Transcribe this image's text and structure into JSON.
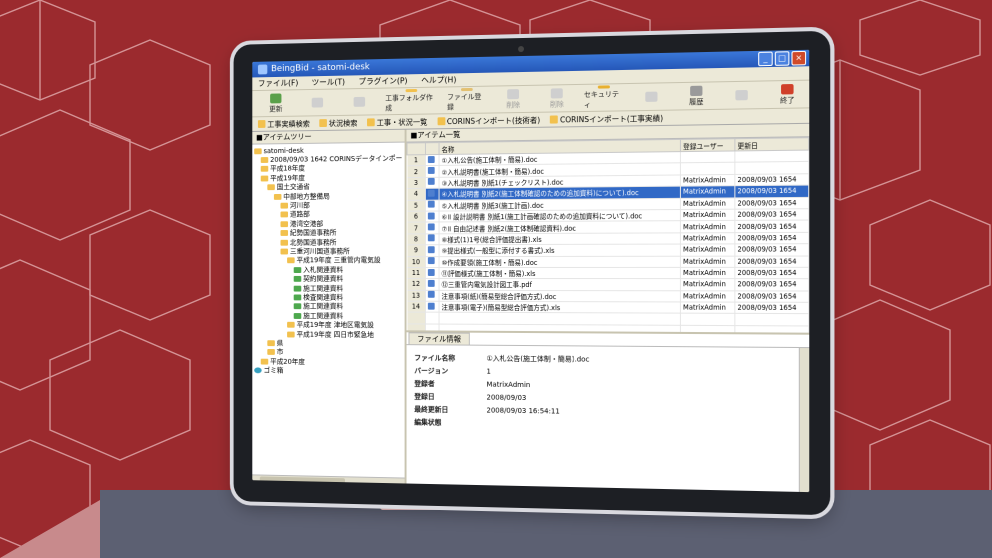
{
  "window": {
    "title": "BeingBid - satomi-desk"
  },
  "menu": [
    "ファイル(F)",
    "ツール(T)",
    "プラグイン(P)",
    "ヘルプ(H)"
  ],
  "toolbar": [
    {
      "label": "更新",
      "icon": "refresh-icon",
      "disabled": false
    },
    {
      "label": "",
      "icon": "blank-icon",
      "disabled": true
    },
    {
      "label": "",
      "icon": "blank-icon",
      "disabled": true
    },
    {
      "label": "工事フォルダ作成",
      "icon": "folder-add-icon",
      "disabled": false
    },
    {
      "label": "ファイル登録",
      "icon": "file-add-icon",
      "disabled": false
    },
    {
      "label": "削除",
      "icon": "delete-icon",
      "disabled": true
    },
    {
      "label": "削除",
      "icon": "trash-icon",
      "disabled": true
    },
    {
      "label": "セキュリティ",
      "icon": "lock-icon",
      "disabled": false
    },
    {
      "label": "",
      "icon": "blank-icon",
      "disabled": true
    },
    {
      "label": "履歴",
      "icon": "history-icon",
      "disabled": false
    },
    {
      "label": "",
      "icon": "blank-icon",
      "disabled": true
    },
    {
      "label": "終了",
      "icon": "exit-icon",
      "disabled": false
    }
  ],
  "toolbar2": [
    "工事実績検索",
    "状況検索",
    "工事・状況一覧",
    "CORINSインポート(技術者)",
    "CORINSインポート(工事実績)"
  ],
  "tree_pane": {
    "header": "■アイテムツリー",
    "nodes": [
      {
        "label": "satomi-desk",
        "level": 0,
        "kind": "root"
      },
      {
        "label": "2008/09/03 1642 CORINSデータインポート",
        "level": 1,
        "kind": "folder"
      },
      {
        "label": "平成18年度",
        "level": 1,
        "kind": "folder"
      },
      {
        "label": "平成19年度",
        "level": 1,
        "kind": "folder"
      },
      {
        "label": "国土交通省",
        "level": 2,
        "kind": "folder"
      },
      {
        "label": "中部地方整備局",
        "level": 3,
        "kind": "folder"
      },
      {
        "label": "河川部",
        "level": 4,
        "kind": "folder"
      },
      {
        "label": "道路部",
        "level": 4,
        "kind": "folder"
      },
      {
        "label": "港湾空港部",
        "level": 4,
        "kind": "folder"
      },
      {
        "label": "紀勢国道事務所",
        "level": 4,
        "kind": "folder"
      },
      {
        "label": "北勢国道事務所",
        "level": 4,
        "kind": "folder"
      },
      {
        "label": "三重河川国道事務所",
        "level": 4,
        "kind": "folder"
      },
      {
        "label": "平成19年度 三重管内電気設",
        "level": 5,
        "kind": "folder"
      },
      {
        "label": "入札関連資料",
        "level": 6,
        "kind": "doc"
      },
      {
        "label": "契約関連資料",
        "level": 6,
        "kind": "doc"
      },
      {
        "label": "施工関連資料",
        "level": 6,
        "kind": "doc"
      },
      {
        "label": "検査関連資料",
        "level": 6,
        "kind": "doc"
      },
      {
        "label": "施工関連資料",
        "level": 6,
        "kind": "doc"
      },
      {
        "label": "施工関連資料",
        "level": 6,
        "kind": "doc"
      },
      {
        "label": "平成19年度 津地区電気設",
        "level": 5,
        "kind": "folder"
      },
      {
        "label": "平成19年度 四日市緊急地",
        "level": 5,
        "kind": "folder"
      },
      {
        "label": "県",
        "level": 2,
        "kind": "folder"
      },
      {
        "label": "市",
        "level": 2,
        "kind": "folder"
      },
      {
        "label": "平成20年度",
        "level": 1,
        "kind": "folder"
      },
      {
        "label": "ゴミ箱",
        "level": 0,
        "kind": "recycle"
      }
    ]
  },
  "list_pane": {
    "header": "■アイテム一覧",
    "columns": [
      "名称",
      "登録ユーザー",
      "更新日"
    ],
    "rows": [
      {
        "num": "1",
        "name": "①入札公告(施工体制・簡易).doc",
        "user": "",
        "date": ""
      },
      {
        "num": "2",
        "name": "②入札説明書(施工体制・簡易).doc",
        "user": "",
        "date": ""
      },
      {
        "num": "3",
        "name": "③入札説明書 別紙1(チェックリスト).doc",
        "user": "MatrixAdmin",
        "date": "2008/09/03 1654"
      },
      {
        "num": "4",
        "name": "④入札説明書 別紙2(施工体制確認のための追加資料)について).doc",
        "user": "MatrixAdmin",
        "date": "2008/09/03 1654"
      },
      {
        "num": "5",
        "name": "⑤入札説明書 別紙3(施工計画).doc",
        "user": "MatrixAdmin",
        "date": "2008/09/03 1654"
      },
      {
        "num": "6",
        "name": "⑥II 設計説明書 別紙1(施工計画確認のための追加資料について).doc",
        "user": "MatrixAdmin",
        "date": "2008/09/03 1654"
      },
      {
        "num": "7",
        "name": "⑦II 自由記述書 別紙2(施工体制確認資料).doc",
        "user": "MatrixAdmin",
        "date": "2008/09/03 1654"
      },
      {
        "num": "8",
        "name": "⑧様式(1)1号(総合評価提出書).xls",
        "user": "MatrixAdmin",
        "date": "2008/09/03 1654"
      },
      {
        "num": "9",
        "name": "⑨提出様式(一般型に添付する書式).xls",
        "user": "MatrixAdmin",
        "date": "2008/09/03 1654"
      },
      {
        "num": "10",
        "name": "⑩作成要領(施工体制・簡易).doc",
        "user": "MatrixAdmin",
        "date": "2008/09/03 1654"
      },
      {
        "num": "11",
        "name": "⑪評価様式(施工体制・簡易).xls",
        "user": "MatrixAdmin",
        "date": "2008/09/03 1654"
      },
      {
        "num": "12",
        "name": "⑫三重管内電気設計図工事.pdf",
        "user": "MatrixAdmin",
        "date": "2008/09/03 1654"
      },
      {
        "num": "13",
        "name": "注意事項(紙)(簡易型総合評価方式).doc",
        "user": "MatrixAdmin",
        "date": "2008/09/03 1654"
      },
      {
        "num": "14",
        "name": "注意事項(電子)(簡易型総合評価方式).xls",
        "user": "MatrixAdmin",
        "date": "2008/09/03 1654"
      }
    ],
    "selected_index": 3
  },
  "detail": {
    "tab": "ファイル情報",
    "fields": [
      {
        "label": "ファイル名称",
        "value": "①入札公告(施工体制・簡易).doc"
      },
      {
        "label": "バージョン",
        "value": "1"
      },
      {
        "label": "登録者",
        "value": "MatrixAdmin"
      },
      {
        "label": "登録日",
        "value": "2008/09/03"
      },
      {
        "label": "最終更新日",
        "value": "2008/09/03 16:54:11"
      },
      {
        "label": "編集状態",
        "value": ""
      }
    ]
  },
  "colors": {
    "background": "#9b2a2e",
    "titlebar": "#2557b8",
    "selection": "#3169c6",
    "folder": "#f2c14e",
    "doc_folder": "#4ea84e"
  }
}
